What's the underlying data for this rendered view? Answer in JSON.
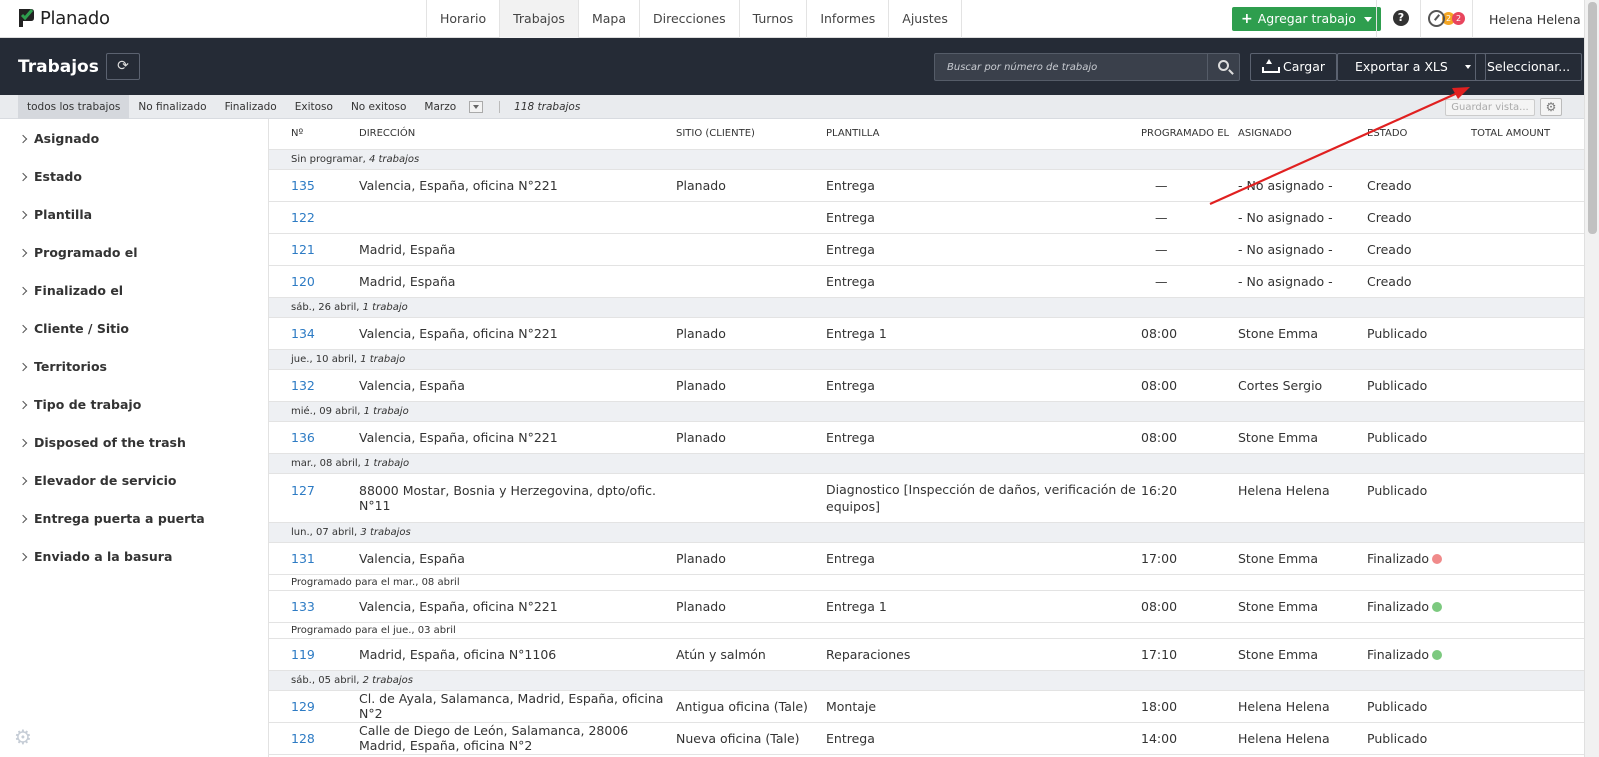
{
  "app": {
    "brand": "Planado"
  },
  "topnav": {
    "tabs": [
      "Horario",
      "Trabajos",
      "Mapa",
      "Direcciones",
      "Turnos",
      "Informes",
      "Ajustes"
    ],
    "active_tab": "Trabajos",
    "add_job_label": "Agregar trabajo",
    "help_label": "?",
    "notif_orange": "2",
    "notif_red": "2",
    "user_name": "Helena Helena"
  },
  "header": {
    "title": "Trabajos",
    "search_placeholder": "Buscar por número de trabajo",
    "upload_label": "Cargar",
    "export_label": "Exportar a XLS",
    "select_label": "Seleccionar..."
  },
  "filters": {
    "tabs": [
      "todos los trabajos",
      "No finalizado",
      "Finalizado",
      "Exitoso",
      "No exitoso",
      "Marzo"
    ],
    "active": "todos los trabajos",
    "count": "118 trabajos",
    "save_view": "Guardar vista..."
  },
  "sidebar": {
    "items": [
      "Asignado",
      "Estado",
      "Plantilla",
      "Programado el",
      "Finalizado el",
      "Cliente / Sitio",
      "Territorios",
      "Tipo de trabajo",
      "Disposed of the trash",
      "Elevador de servicio",
      "Entrega puerta a puerta",
      "Enviado a la basura"
    ]
  },
  "table": {
    "columns": [
      "Nº",
      "DIRECCIÓN",
      "SITIO (CLIENTE)",
      "PLANTILLA",
      "PROGRAMADO EL",
      "ASIGNADO",
      "ESTADO",
      "TOTAL AMOUNT"
    ],
    "groups": [
      {
        "label": "Sin programar,",
        "count": "4 trabajos",
        "rows": [
          {
            "num": "135",
            "dir": "Valencia, España, oficina N°221",
            "site": "Planado",
            "tpl": "Entrega",
            "time": "—",
            "assigned": "- No asignado -",
            "status": "Creado"
          },
          {
            "num": "122",
            "dir": "",
            "site": "",
            "tpl": "Entrega",
            "time": "—",
            "assigned": "- No asignado -",
            "status": "Creado"
          },
          {
            "num": "121",
            "dir": "Madrid, España",
            "site": "",
            "tpl": "Entrega",
            "time": "—",
            "assigned": "- No asignado -",
            "status": "Creado"
          },
          {
            "num": "120",
            "dir": "Madrid, España",
            "site": "",
            "tpl": "Entrega",
            "time": "—",
            "assigned": "- No asignado -",
            "status": "Creado"
          }
        ]
      },
      {
        "label": "sáb., 26 abril,",
        "count": "1 trabajo",
        "rows": [
          {
            "num": "134",
            "dir": "Valencia, España, oficina N°221",
            "site": "Planado",
            "tpl": "Entrega 1",
            "time": "08:00",
            "assigned": "Stone Emma",
            "status": "Publicado"
          }
        ]
      },
      {
        "label": "jue., 10 abril,",
        "count": "1 trabajo",
        "rows": [
          {
            "num": "132",
            "dir": "Valencia, España",
            "site": "Planado",
            "tpl": "Entrega",
            "time": "08:00",
            "assigned": "Cortes Sergio",
            "status": "Publicado"
          }
        ]
      },
      {
        "label": "mié., 09 abril,",
        "count": "1 trabajo",
        "rows": [
          {
            "num": "136",
            "dir": "Valencia, España, oficina N°221",
            "site": "Planado",
            "tpl": "Entrega",
            "time": "08:00",
            "assigned": "Stone Emma",
            "status": "Publicado"
          }
        ]
      },
      {
        "label": "mar., 08 abril,",
        "count": "1 trabajo",
        "rows": [
          {
            "num": "127",
            "dir": "88000 Mostar, Bosnia y Herzegovina, dpto/ofic. N°11",
            "site": "",
            "tpl": "Diagnostico [Inspección de daños, verificación de equipos]",
            "time": "16:20",
            "assigned": "Helena Helena",
            "status": "Publicado"
          }
        ]
      },
      {
        "label": "lun., 07 abril,",
        "count": "3 trabajos",
        "rows": [
          {
            "num": "131",
            "dir": "Valencia, España",
            "site": "Planado",
            "tpl": "Entrega",
            "time": "17:00",
            "assigned": "Stone Emma",
            "status": "Finalizado"
          },
          {
            "sched": "Programado para el mar., 08 abril"
          },
          {
            "num": "133",
            "dir": "Valencia, España, oficina N°221",
            "site": "Planado",
            "tpl": "Entrega 1",
            "time": "08:00",
            "assigned": "Stone Emma",
            "status": "Finalizado"
          },
          {
            "sched": "Programado para el jue., 03 abril"
          },
          {
            "num": "119",
            "dir": "Madrid, España, oficina N°1106",
            "site": "Atún y salmón",
            "tpl": "Reparaciones",
            "time": "17:10",
            "assigned": "Stone Emma",
            "status": "Finalizado"
          }
        ]
      },
      {
        "label": "sáb., 05 abril,",
        "count": "2 trabajos",
        "rows": [
          {
            "num": "129",
            "dir": "Cl. de Ayala, Salamanca, Madrid, España, oficina N°2",
            "site": "Antigua oficina (Tale)",
            "tpl": "Montaje",
            "time": "18:00",
            "assigned": "Helena Helena",
            "status": "Publicado"
          },
          {
            "num": "128",
            "dir": "Calle de Diego de León, Salamanca, 28006 Madrid, España, oficina N°2",
            "site": "Nueva oficina (Tale)",
            "tpl": "Entrega",
            "time": "14:00",
            "assigned": "Helena Helena",
            "status": "Publicado"
          }
        ]
      }
    ],
    "status_dots": {
      "131": "red",
      "133": "green",
      "119": "green"
    }
  },
  "colors": {
    "brand_green": "#2e9e4e",
    "header_dark": "#252b36",
    "link_blue": "#2d7bc4",
    "arrow_red": "#e02020"
  }
}
